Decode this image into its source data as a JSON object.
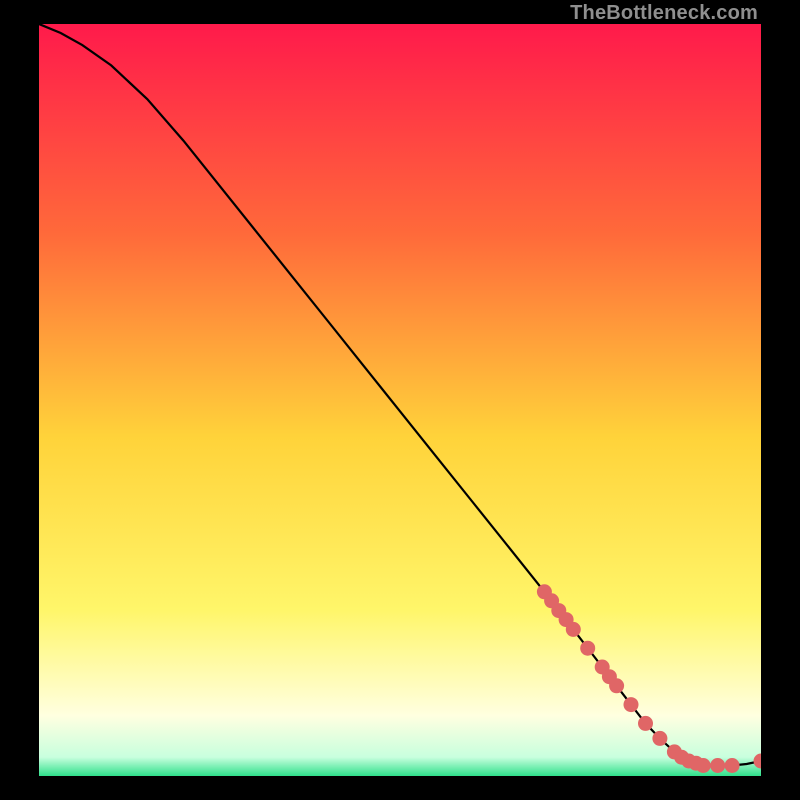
{
  "watermark": "TheBottleneck.com",
  "colors": {
    "gradient_top": "#ff1a4b",
    "gradient_mid_upper": "#ff6a3a",
    "gradient_mid": "#ffd33a",
    "gradient_mid_lower": "#fff66a",
    "gradient_lower": "#ffffe0",
    "gradient_bottom": "#2fe08b",
    "curve": "#000000",
    "marker": "#e06666"
  },
  "chart_data": {
    "type": "line",
    "title": "",
    "xlabel": "",
    "ylabel": "",
    "xlim": [
      0,
      100
    ],
    "ylim": [
      0,
      100
    ],
    "series": [
      {
        "name": "bottleneck-curve",
        "x": [
          0,
          3,
          6,
          10,
          15,
          20,
          25,
          30,
          35,
          40,
          45,
          50,
          55,
          60,
          65,
          70,
          74,
          78,
          80,
          82,
          84,
          86,
          88,
          90,
          92,
          94,
          96,
          98,
          100
        ],
        "y": [
          100,
          98.8,
          97.2,
          94.5,
          90,
          84.5,
          78.5,
          72.5,
          66.5,
          60.5,
          54.5,
          48.5,
          42.5,
          36.5,
          30.5,
          24.5,
          19.5,
          14.5,
          12,
          9.5,
          7,
          5,
          3.2,
          2,
          1.4,
          1.4,
          1.4,
          1.6,
          2
        ]
      }
    ],
    "markers": {
      "name": "highlighted-points",
      "points": [
        {
          "x": 70,
          "y": 24.5
        },
        {
          "x": 71,
          "y": 23.3
        },
        {
          "x": 72,
          "y": 22
        },
        {
          "x": 73,
          "y": 20.8
        },
        {
          "x": 74,
          "y": 19.5
        },
        {
          "x": 76,
          "y": 17
        },
        {
          "x": 78,
          "y": 14.5
        },
        {
          "x": 79,
          "y": 13.2
        },
        {
          "x": 80,
          "y": 12
        },
        {
          "x": 82,
          "y": 9.5
        },
        {
          "x": 84,
          "y": 7
        },
        {
          "x": 86,
          "y": 5
        },
        {
          "x": 88,
          "y": 3.2
        },
        {
          "x": 89,
          "y": 2.5
        },
        {
          "x": 90,
          "y": 2
        },
        {
          "x": 91,
          "y": 1.7
        },
        {
          "x": 92,
          "y": 1.4
        },
        {
          "x": 94,
          "y": 1.4
        },
        {
          "x": 96,
          "y": 1.4
        },
        {
          "x": 100,
          "y": 2
        }
      ]
    }
  }
}
